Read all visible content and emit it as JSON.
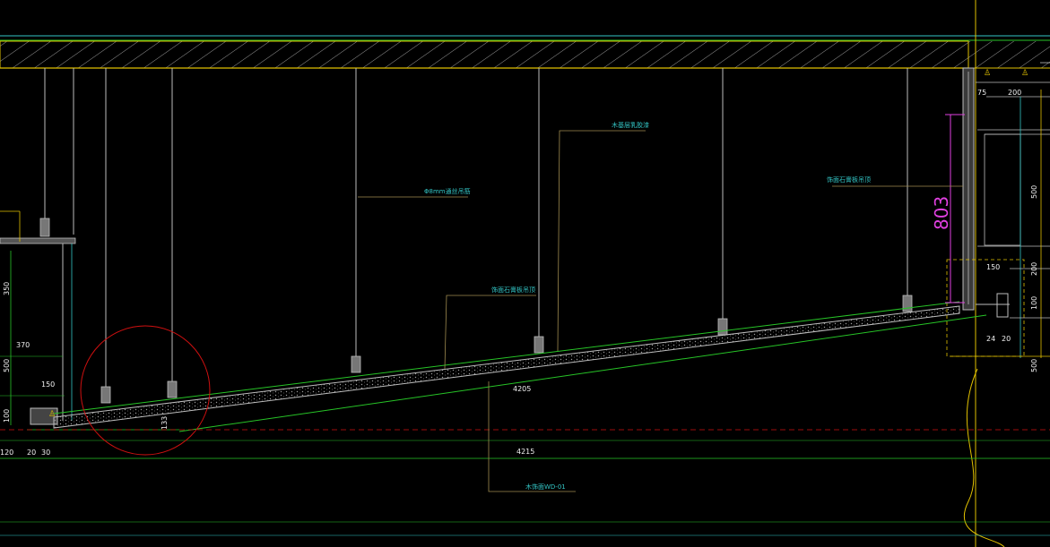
{
  "app": "CAD section drawing",
  "colors": {
    "background": "#000000",
    "cyan": "#33c6c6",
    "green": "#27c427",
    "yellow": "#e0c000",
    "gray": "#bdbdbd",
    "white": "#f0f0f0",
    "magenta": "#e040e0",
    "red": "#d01010",
    "olive": "#a08c50"
  },
  "labels": {
    "rod_label": "Φ8mm通丝吊筋",
    "paint_label": "木基层乳胶漆",
    "stone_label_center": "饰面石膏板吊顶",
    "stone_label_right": "饰面石膏板吊顶",
    "code_label": "木饰面WD-01"
  },
  "dimensions": {
    "big_vertical": "803",
    "slope_top": "4205",
    "slope_bottom": "4215",
    "right_top_75": "75",
    "right_top_200": "200",
    "right_500_upper": "500",
    "right_200": "200",
    "right_150": "150",
    "right_100": "100",
    "right_24": "24",
    "right_20": "20",
    "right_500_lower": "500",
    "left_350": "350",
    "left_370": "370",
    "left_500": "500",
    "left_150": "150",
    "left_100": "100",
    "bottom_120": "120",
    "bottom_20": "20",
    "bottom_30": "30",
    "small_vertical": "133"
  }
}
